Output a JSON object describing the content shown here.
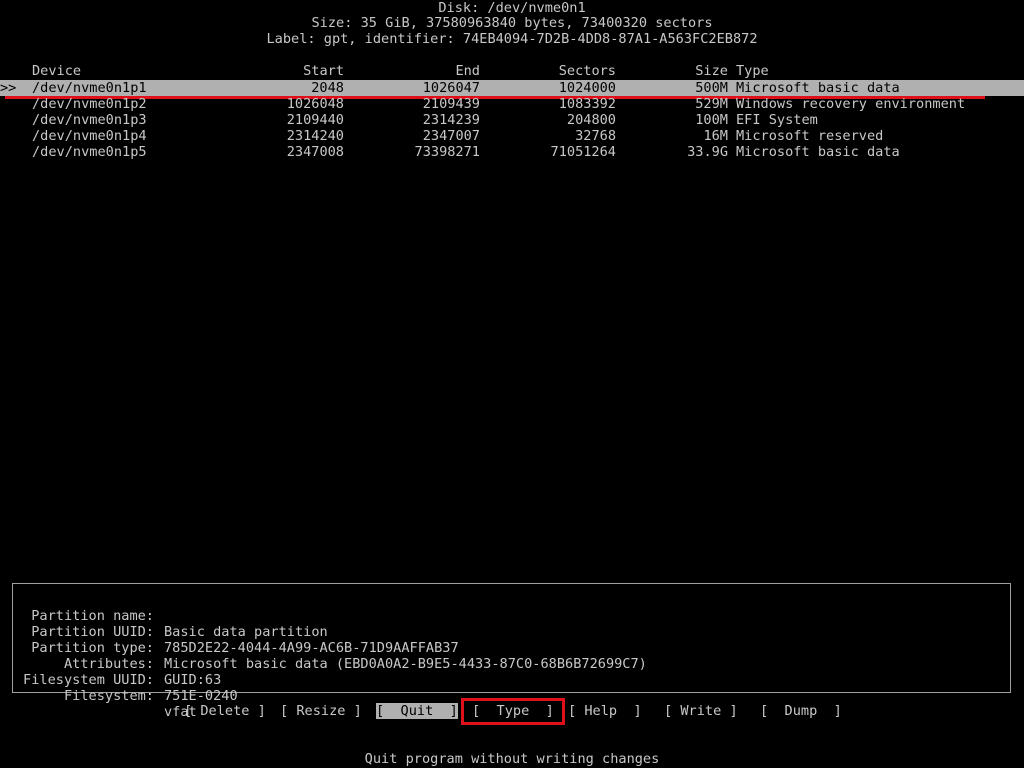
{
  "header": {
    "disk": "Disk: /dev/nvme0n1",
    "size": "Size: 35 GiB, 37580963840 bytes, 73400320 sectors",
    "label": "Label: gpt, identifier: 74EB4094-7D2B-4DD8-87A1-A563FC2EB872"
  },
  "table": {
    "columns": {
      "device": "Device",
      "start": "Start",
      "end": "End",
      "sectors": "Sectors",
      "size": "Size",
      "type": "Type"
    },
    "cursor": ">>",
    "rows": [
      {
        "device": "/dev/nvme0n1p1",
        "start": "2048",
        "end": "1026047",
        "sectors": "1024000",
        "size": "500M",
        "type": "Microsoft basic data"
      },
      {
        "device": "/dev/nvme0n1p2",
        "start": "1026048",
        "end": "2109439",
        "sectors": "1083392",
        "size": "529M",
        "type": "Windows recovery environment"
      },
      {
        "device": "/dev/nvme0n1p3",
        "start": "2109440",
        "end": "2314239",
        "sectors": "204800",
        "size": "100M",
        "type": "EFI System"
      },
      {
        "device": "/dev/nvme0n1p4",
        "start": "2314240",
        "end": "2347007",
        "sectors": "32768",
        "size": "16M",
        "type": "Microsoft reserved"
      },
      {
        "device": "/dev/nvme0n1p5",
        "start": "2347008",
        "end": "73398271",
        "sectors": "71051264",
        "size": "33.9G",
        "type": "Microsoft basic data"
      }
    ]
  },
  "info": {
    "partition_name_key": "Partition name:",
    "partition_name": "Basic data partition",
    "partition_uuid_key": "Partition UUID:",
    "partition_uuid": "785D2E22-4044-4A99-AC6B-71D9AAFFAB37",
    "partition_type_key": "Partition type:",
    "partition_type": "Microsoft basic data (EBD0A0A2-B9E5-4433-87C0-68B6B72699C7)",
    "attributes_key": "Attributes:",
    "attributes": "GUID:63",
    "fs_uuid_key": "Filesystem UUID:",
    "fs_uuid": "751E-0240",
    "filesystem_key": "Filesystem:",
    "filesystem": "vfat"
  },
  "buttons": {
    "delete": "[ Delete ]",
    "resize": "[ Resize ]",
    "quit": "[  Quit  ]",
    "type": "[  Type  ]",
    "help": "[ Help  ]",
    "write": "[ Write ]",
    "dump": "[  Dump  ]"
  },
  "status": "Quit program without writing changes",
  "colors": {
    "background": "#000000",
    "text": "#c8c8c8",
    "selection": "#b0b0b0",
    "highlight_red": "#e0101a"
  }
}
